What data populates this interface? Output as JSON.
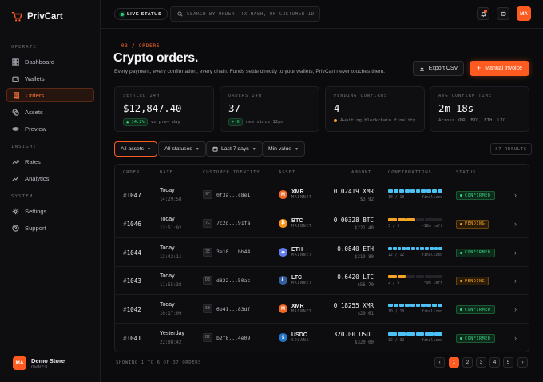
{
  "app": {
    "name": "PrivCart"
  },
  "sidebar": {
    "sections": [
      {
        "label": "OPERATE",
        "items": [
          {
            "label": "Dashboard",
            "icon": "grid-icon"
          },
          {
            "label": "Wallets",
            "icon": "wallet-icon"
          },
          {
            "label": "Orders",
            "icon": "receipt-icon",
            "active": true
          },
          {
            "label": "Assets",
            "icon": "coins-icon"
          },
          {
            "label": "Preview",
            "icon": "eye-icon"
          }
        ]
      },
      {
        "label": "INSIGHT",
        "items": [
          {
            "label": "Rates",
            "icon": "trend-icon"
          },
          {
            "label": "Analytics",
            "icon": "chart-icon"
          }
        ]
      },
      {
        "label": "SYSTEM",
        "items": [
          {
            "label": "Settings",
            "icon": "gear-icon"
          },
          {
            "label": "Support",
            "icon": "help-icon"
          }
        ]
      }
    ],
    "store": {
      "initials": "MA",
      "name": "Demo Store",
      "role": "OWNER"
    }
  },
  "header": {
    "live_label": "LIVE STATUS",
    "search_placeholder": "SEARCH BY ORDER, TX HASH, OR CUSTOMER ID",
    "avatar_initials": "MA"
  },
  "page": {
    "crumb": "— 03 / ORDERS",
    "title": "Crypto orders.",
    "subtitle": "Every payment, every confirmation, every chain. Funds settle directly to your wallets; PrivCart never touches them.",
    "export_label": "Export CSV",
    "manual_label": "Manual invoice"
  },
  "stats": [
    {
      "label": "SETTLED 24H",
      "value": "$12,847.40",
      "delta": "▲ 14.2%",
      "note": "vs prev day"
    },
    {
      "label": "ORDERS 24H",
      "value": "37",
      "delta": "+ 6",
      "note": "new since 12pm"
    },
    {
      "label": "PENDING CONFIRMS",
      "value": "4",
      "note": "Awaiting blockchain finality"
    },
    {
      "label": "AVG CONFIRM TIME",
      "value": "2m 18s",
      "note": "Across XMR, BTC, ETH, LTC"
    }
  ],
  "filters": {
    "assets": "All assets",
    "statuses": "All statuses",
    "range": "Last 7 days",
    "value": "Min value",
    "results": "37 RESULTS"
  },
  "table": {
    "columns": [
      "ORDER",
      "DATE",
      "CUSTOMER IDENTITY",
      "ASSET",
      "AMOUNT",
      "CONFIRMATIONS",
      "STATUS"
    ],
    "rows": [
      {
        "order": "1047",
        "date": "Today",
        "time": "14:29:58",
        "cust_badge": "9F",
        "cust": "0f3a...c8e1",
        "asset": "XMR",
        "net": "MAINNET",
        "coin_color": "#f26822",
        "coin_glyph": "M",
        "amount": "0.02419 XMR",
        "usd": "$3.92",
        "conf_done": 10,
        "conf_total": 10,
        "conf_color": "#4cc3f7",
        "conf_label": "10 / 10",
        "conf_note": "finalized",
        "status": "CONFIRMED",
        "status_kind": "confirmed"
      },
      {
        "order": "1046",
        "date": "Today",
        "time": "13:51:02",
        "cust_badge": "7C",
        "cust": "7c2d...91fa",
        "asset": "BTC",
        "net": "MAINNET",
        "coin_color": "#f7931a",
        "coin_glyph": "₿",
        "amount": "0.00328 BTC",
        "usd": "$221.40",
        "conf_done": 3,
        "conf_total": 6,
        "conf_color": "#f5a524",
        "conf_label": "3 / 6",
        "conf_note": "~18m left",
        "status": "PENDING",
        "status_kind": "pending"
      },
      {
        "order": "1044",
        "date": "Today",
        "time": "12:42:11",
        "cust_badge": "3E",
        "cust": "3e10...bb44",
        "asset": "ETH",
        "net": "MAINNET",
        "coin_color": "#627eea",
        "coin_glyph": "◆",
        "amount": "0.0840 ETH",
        "usd": "$219.80",
        "conf_done": 12,
        "conf_total": 12,
        "conf_color": "#4cc3f7",
        "conf_label": "12 / 12",
        "conf_note": "finalized",
        "status": "CONFIRMED",
        "status_kind": "confirmed"
      },
      {
        "order": "1043",
        "date": "Today",
        "time": "11:55:38",
        "cust_badge": "D8",
        "cust": "d822...50ac",
        "asset": "LTC",
        "net": "MAINNET",
        "coin_color": "#345d9d",
        "coin_glyph": "Ł",
        "amount": "0.6420 LTC",
        "usd": "$56.70",
        "conf_done": 2,
        "conf_total": 6,
        "conf_color": "#f5a524",
        "conf_label": "2 / 6",
        "conf_note": "~9m left",
        "status": "PENDING",
        "status_kind": "pending"
      },
      {
        "order": "1042",
        "date": "Today",
        "time": "10:17:09",
        "cust_badge": "6B",
        "cust": "6b41...83df",
        "asset": "XMR",
        "net": "MAINNET",
        "coin_color": "#f26822",
        "coin_glyph": "M",
        "amount": "0.18255 XMR",
        "usd": "$29.61",
        "conf_done": 10,
        "conf_total": 10,
        "conf_color": "#4cc3f7",
        "conf_label": "10 / 10",
        "conf_note": "finalized",
        "status": "CONFIRMED",
        "status_kind": "confirmed"
      },
      {
        "order": "1041",
        "date": "Yesterday",
        "time": "22:08:42",
        "cust_badge": "B2",
        "cust": "b2f8...4e09",
        "asset": "USDC",
        "net": "SOLANA",
        "coin_color": "#2775ca",
        "coin_glyph": "$",
        "amount": "320.00 USDC",
        "usd": "$320.00",
        "conf_done": 6,
        "conf_total": 6,
        "conf_color": "#4cc3f7",
        "conf_label": "32 / 32",
        "conf_note": "finalized",
        "status": "CONFIRMED",
        "status_kind": "confirmed"
      }
    ]
  },
  "footer": {
    "showing": "SHOWING 1 TO 6 OF 37 ORDERS",
    "pages": [
      "1",
      "2",
      "3",
      "4",
      "5"
    ],
    "current_page": "1",
    "prev": "‹",
    "next": "›"
  },
  "colors": {
    "accent": "#ff5a1f",
    "confirmed": "#36d987",
    "pending": "#f5a524",
    "progress": "#4cc3f7"
  }
}
